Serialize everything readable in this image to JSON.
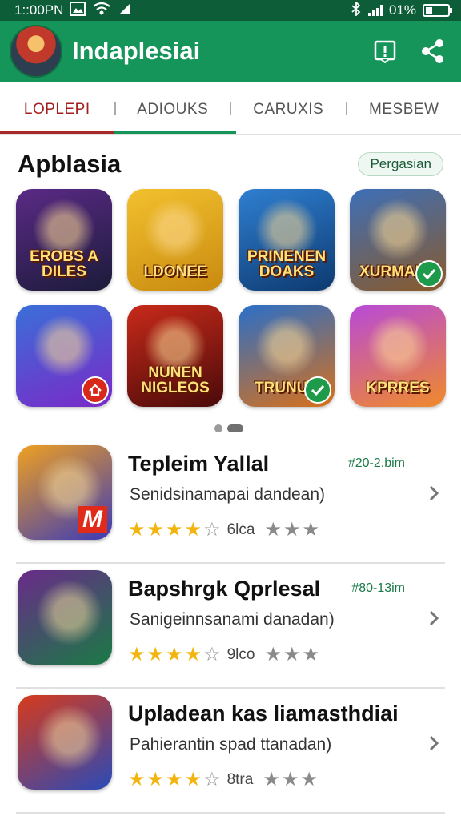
{
  "status_bar": {
    "time": "1::00PN",
    "battery": "01%"
  },
  "app_bar": {
    "title": "Indaplesiai",
    "logo_icon": "game-hero-logo",
    "actions": [
      "report-icon",
      "share-icon"
    ]
  },
  "tabs": [
    {
      "label": "LOPLEPI",
      "active": true
    },
    {
      "label": "ADIOUKS",
      "active": false
    },
    {
      "label": "CARUXIS",
      "active": false
    },
    {
      "label": "MESBEW",
      "active": false
    }
  ],
  "section": {
    "title": "Apblasia",
    "chip": "Pergasian"
  },
  "tiles": [
    {
      "label": "EROBS A DILES",
      "colors": [
        "#5b2a86",
        "#1b1b3a"
      ],
      "badge": ""
    },
    {
      "label": "LDONEE",
      "colors": [
        "#f2c12e",
        "#c98a10"
      ],
      "badge": ""
    },
    {
      "label": "PRINENEN DOAKS",
      "colors": [
        "#2f7fd1",
        "#0d3a70"
      ],
      "badge": ""
    },
    {
      "label": "XURMANS",
      "colors": [
        "#3d6fb8",
        "#8a5a2a"
      ],
      "badge": "check"
    },
    {
      "label": "",
      "colors": [
        "#3a6fd8",
        "#7a2ac8"
      ],
      "badge": "home"
    },
    {
      "label": "NUNEN NIGLEOS",
      "colors": [
        "#c82a1a",
        "#4a0a0a"
      ],
      "badge": ""
    },
    {
      "label": "TRUNUR",
      "colors": [
        "#2a6fc8",
        "#d8701a"
      ],
      "badge": "check"
    },
    {
      "label": "KPRRES",
      "colors": [
        "#b84ad8",
        "#f08a2a"
      ],
      "badge": ""
    }
  ],
  "list_items": [
    {
      "title": "Tepleim Yallal",
      "meta": "#20-2.bim",
      "subtitle": "Senidsinamapai dandean)",
      "rating_label": "6lca",
      "icon_colors": [
        "#f0a020",
        "#3a3ab8"
      ],
      "icon_badge": "M"
    },
    {
      "title": "Bapshrgk Qprlesal",
      "meta": "#80-13im",
      "subtitle": "Sanigeinnsanami danadan)",
      "rating_label": "9lco",
      "icon_colors": [
        "#6a2a8a",
        "#1a7a45"
      ],
      "icon_badge": ""
    },
    {
      "title": "Upladean kas liamasthdiai",
      "meta": "",
      "subtitle": "Pahierantin spad ttanadan)",
      "rating_label": "8tra",
      "icon_colors": [
        "#d83a1a",
        "#2a4ab8"
      ],
      "icon_badge": ""
    }
  ],
  "colors": {
    "status_bar": "#0d5e38",
    "app_bar": "#16955a",
    "accent_red": "#a62a2a",
    "accent_green": "#16955a",
    "star": "#f2b50f"
  }
}
